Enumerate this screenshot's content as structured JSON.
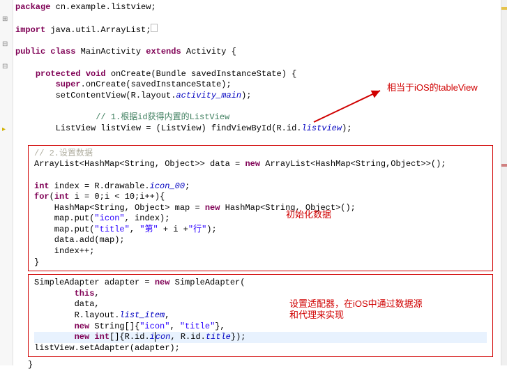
{
  "package_line": "package cn.example.listview;",
  "import_line": "import java.util.ArrayList;",
  "class_decl": {
    "pre": "public class ",
    "name": "MainActivity ",
    "ext": "extends ",
    "sup": "Activity {"
  },
  "method_decl": {
    "pre": "    protected void ",
    "name": "onCreate",
    "args": "(Bundle savedInstanceState) {"
  },
  "super_line": {
    "pre": "        super",
    "call": ".onCreate(savedInstanceState);"
  },
  "setcontent": {
    "pre": "        setContentView(R.layout.",
    "field": "activity_main",
    "post": ");"
  },
  "cmt1": "        // 1.根据id获得内置的ListView",
  "lv_line": {
    "a": "        ListView listView = (ListView) findViewById(R.id.",
    "f": "listview",
    "b": ");"
  },
  "cmt2": "// 2.设置数据",
  "arraylist_line": {
    "a": "ArrayList<HashMap<String, Object>> data = ",
    "n": "new ",
    "b": "ArrayList<HashMap<String,Object>>();"
  },
  "idx_line": {
    "a": "int ",
    "b": "index = R.drawable.",
    "f": "icon_00",
    "c": ";"
  },
  "for_line": {
    "a": "for",
    "b": "(",
    "c": "int ",
    "d": "i = 0;i < 10;i++){"
  },
  "hm_line": {
    "a": "    HashMap<String, Object> map = ",
    "n": "new ",
    "b": "HashMap<String, Object>();"
  },
  "put1": {
    "a": "    map.put(",
    "s": "\"icon\"",
    "b": ", index);"
  },
  "put2": {
    "a": "    map.put(",
    "s1": "\"title\"",
    "b": ", ",
    "s2": "\"第\"",
    "c": " + i +",
    "s3": "\"行\"",
    "d": ");"
  },
  "add_line": "    data.add(map);",
  "inc_line": "    index++;",
  "close_for": "}",
  "adapter_line": {
    "a": "SimpleAdapter adapter = ",
    "n": "new ",
    "b": "SimpleAdapter("
  },
  "arg_this": {
    "a": "        this",
    "b": ","
  },
  "arg_data": "        data,",
  "arg_layout": {
    "a": "        R.layout.",
    "f": "list_item",
    "b": ","
  },
  "arg_str": {
    "a": "        new ",
    "b": "String[]{",
    "s1": "\"icon\"",
    "c": ", ",
    "s2": "\"title\"",
    "d": "},"
  },
  "arg_int": {
    "a": "        new int",
    "b": "[]{R.id.",
    "f1": "icon",
    "c": ", R.id.",
    "f2": "title",
    "d": "});"
  },
  "setadapter": "listView.setAdapter(adapter);",
  "annot1": "相当于iOS的tableView",
  "annot2": "初始化数据",
  "annot3a": "设置适配器，在iOS中通过数据源",
  "annot3b": "和代理来实现"
}
